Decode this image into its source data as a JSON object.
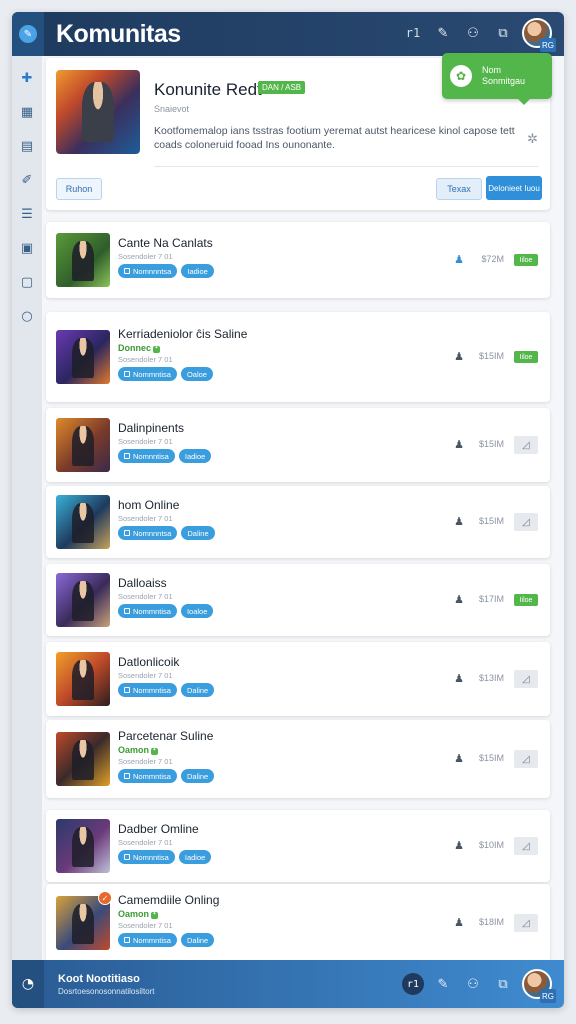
{
  "colors": {
    "header": "#1e3a5f",
    "accent": "#2f8fd8",
    "green": "#53b64a",
    "orange": "#e8672a"
  },
  "header": {
    "title": "Komunitas",
    "icons": [
      {
        "name": "counter-icon",
        "glyph": "r1"
      },
      {
        "name": "pen-icon",
        "glyph": "✎"
      },
      {
        "name": "users-icon",
        "glyph": "⚇"
      },
      {
        "name": "share-icon",
        "glyph": "⧉"
      }
    ],
    "avatar_tag": "RG"
  },
  "sidebar": {
    "icons": [
      {
        "name": "puzzle-icon",
        "glyph": "✚"
      },
      {
        "name": "grid-icon",
        "glyph": "▦"
      },
      {
        "name": "table-icon",
        "glyph": "▤"
      },
      {
        "name": "pin-icon",
        "glyph": "✐"
      },
      {
        "name": "list-icon",
        "glyph": "☰"
      },
      {
        "name": "calendar-icon",
        "glyph": "▣"
      },
      {
        "name": "image-icon",
        "glyph": "▢"
      },
      {
        "name": "circle-icon",
        "glyph": "○"
      }
    ]
  },
  "tooltip": {
    "line1": "Nom",
    "line2": "Sonmitgau"
  },
  "feature": {
    "title": "Konunite Redt",
    "badge": "DAN / ASB",
    "subtitle": "Snaievot",
    "description": "Kootfomemalop ians tsstras footium yeremat autst hearicese kinol capose tett coads coloneruid fooad Ins ounonante.",
    "btn_left": "Ruhon",
    "btn_secondary": "Texax",
    "btn_primary": "Delonieet Iuou"
  },
  "items": [
    {
      "title": "Cante  Na Canlats",
      "green": "",
      "sub": "Sosendoler 7 01",
      "tag1": "Nomnnntsa",
      "tag2": "Iadioe",
      "price": "$72M",
      "status": "on",
      "person_blue": true,
      "notif": false
    },
    {
      "title": "Kerriadeniolor ĉis Saline",
      "green": "Donnec",
      "sub": "Sosendoler 7 01",
      "tag1": "Nommntisa",
      "tag2": "Oaloe",
      "price": "$15IM",
      "status": "on",
      "person_blue": false,
      "notif": false
    },
    {
      "title": "Dalinpinents",
      "green": "",
      "sub": "Sosendoler 7 01",
      "tag1": "Nomnntisa",
      "tag2": "Iadioe",
      "price": "$15IM",
      "status": "off",
      "person_blue": false,
      "notif": false
    },
    {
      "title": "hom Online",
      "green": "",
      "sub": "Sosendoler 7 01",
      "tag1": "Nomnnntsa",
      "tag2": "Daline",
      "price": "$15IM",
      "status": "off",
      "person_blue": false,
      "notif": false
    },
    {
      "title": "Dalloaiss",
      "green": "",
      "sub": "Sosendoler 7 01",
      "tag1": "Nommntisa",
      "tag2": "Ioaloe",
      "price": "$17IM",
      "status": "on",
      "person_blue": false,
      "notif": false
    },
    {
      "title": "Datlonlicoik",
      "green": "",
      "sub": "Sosendoler 7 01",
      "tag1": "Nommntisa",
      "tag2": "Daline",
      "price": "$13IM",
      "status": "off",
      "person_blue": false,
      "notif": false
    },
    {
      "title": "Parcetenar Suline",
      "green": "Oamon",
      "sub": "Sosendoler 7 01",
      "tag1": "Nommntisa",
      "tag2": "Daline",
      "price": "$15IM",
      "status": "off",
      "person_blue": false,
      "notif": false
    },
    {
      "title": "Dadber Omline",
      "green": "",
      "sub": "Sosendoler 7 01",
      "tag1": "Nomnntisa",
      "tag2": "Iadioe",
      "price": "$10IM",
      "status": "off",
      "person_blue": false,
      "notif": false
    },
    {
      "title": "Camemdiile Onling",
      "green": "Oamon",
      "sub": "Sosendoler 7 01",
      "tag1": "Nommntisa",
      "tag2": "Daline",
      "price": "$18IM",
      "status": "off",
      "person_blue": false,
      "notif": true
    }
  ],
  "status_on_label": "Iiloe",
  "status_off_glyph": "◿",
  "person_glyph": "♟",
  "footer": {
    "title": "Koot Nootitiaso",
    "subtitle": "Dosrtoesonosonnatilosiltort",
    "badge": "r1",
    "avatar_tag": "RG"
  }
}
